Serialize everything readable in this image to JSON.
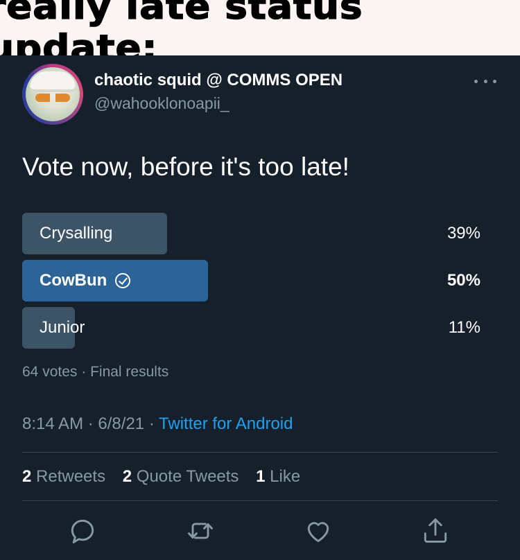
{
  "caption": "really late status update:",
  "tweet": {
    "display_name": "chaotic squid @ COMMS OPEN",
    "handle": "@wahooklonoapii_",
    "text": "Vote now, before it's too late!",
    "poll": {
      "options": [
        {
          "label": "Crysalling",
          "percent": "39%",
          "value": 39,
          "winner": false
        },
        {
          "label": "CowBun",
          "percent": "50%",
          "value": 50,
          "winner": true
        },
        {
          "label": "Junior",
          "percent": "11%",
          "value": 11,
          "winner": false
        }
      ],
      "votes": "64 votes",
      "status": "Final results",
      "separator": "·"
    },
    "time": "8:14 AM",
    "date": "6/8/21",
    "source": "Twitter for Android",
    "stats": {
      "retweets_count": "2",
      "retweets_label": "Retweets",
      "quotes_count": "2",
      "quotes_label": "Quote Tweets",
      "likes_count": "1",
      "likes_label": "Like"
    }
  },
  "icons": {
    "more": "more-dots-icon",
    "reply": "reply-icon",
    "retweet": "retweet-icon",
    "like": "heart-icon",
    "share": "share-icon",
    "winner": "check-circle-icon"
  },
  "colors": {
    "background": "#15202b",
    "poll_bar": "#3d5466",
    "poll_winner": "#2c6497",
    "link": "#1da1f2",
    "muted": "#8899a6"
  }
}
